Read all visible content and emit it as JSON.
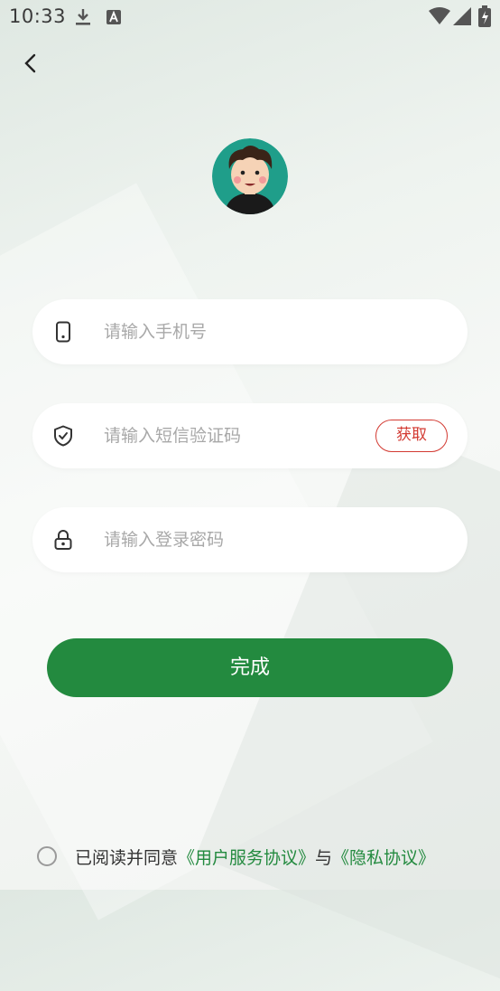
{
  "status_bar": {
    "time": "10:33"
  },
  "avatar": {
    "icon": "avatar-boy-icon"
  },
  "fields": {
    "phone": {
      "placeholder": "请输入手机号",
      "icon": "phone-icon"
    },
    "sms": {
      "placeholder": "请输入短信验证码",
      "icon": "shield-check-icon",
      "get_label": "获取"
    },
    "password": {
      "placeholder": "请输入登录密码",
      "icon": "lock-icon"
    }
  },
  "submit_label": "完成",
  "agreement": {
    "prefix": "已阅读并同意",
    "user_agreement": "《用户服务协议》",
    "connector": "与",
    "privacy": "《隐私协议》",
    "checked": false
  },
  "colors": {
    "accent": "#238a3f",
    "danger": "#d33a32"
  }
}
